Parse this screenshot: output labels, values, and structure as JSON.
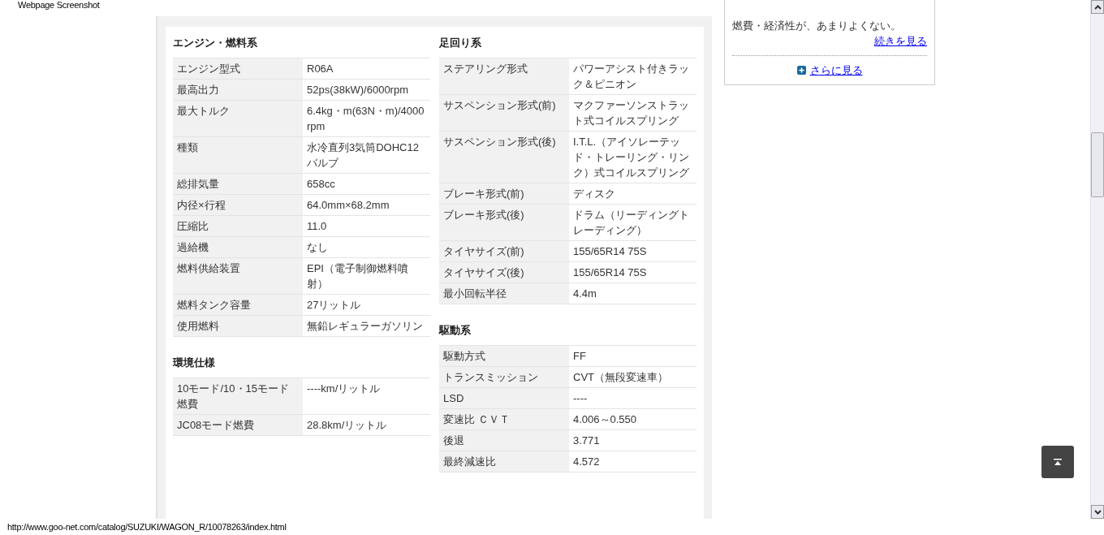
{
  "caption": "Webpage Screenshot",
  "columns": [
    {
      "sections": [
        {
          "title": "エンジン・燃料系",
          "rows": [
            {
              "label": "エンジン型式",
              "value": "R06A"
            },
            {
              "label": "最高出力",
              "value": "52ps(38kW)/6000rpm"
            },
            {
              "label": "最大トルク",
              "value": "6.4kg・m(63N・m)/4000rpm"
            },
            {
              "label": "種類",
              "value": "水冷直列3気筒DOHC12バルブ"
            },
            {
              "label": "総排気量",
              "value": "658cc"
            },
            {
              "label": "内径×行程",
              "value": "64.0mm×68.2mm"
            },
            {
              "label": "圧縮比",
              "value": "11.0"
            },
            {
              "label": "過給機",
              "value": "なし"
            },
            {
              "label": "燃料供給装置",
              "value": "EPI（電子制御燃料噴射）"
            },
            {
              "label": "燃料タンク容量",
              "value": "27リットル"
            },
            {
              "label": "使用燃料",
              "value": "無鉛レギュラーガソリン"
            }
          ]
        },
        {
          "title": "環境仕様",
          "rows": [
            {
              "label": "10モード/10・15モード燃費",
              "value": "----km/リットル"
            },
            {
              "label": "JC08モード燃費",
              "value": "28.8km/リットル"
            }
          ]
        }
      ]
    },
    {
      "sections": [
        {
          "title": "足回り系",
          "rows": [
            {
              "label": "ステアリング形式",
              "value": "パワーアシスト付きラック＆ピニオン"
            },
            {
              "label": "サスペンション形式(前)",
              "value": "マクファーソンストラット式コイルスプリング"
            },
            {
              "label": "サスペンション形式(後)",
              "value": "I.T.L.（アイソレーテッド・トレーリング・リンク）式コイルスプリング"
            },
            {
              "label": "ブレーキ形式(前)",
              "value": "ディスク"
            },
            {
              "label": "ブレーキ形式(後)",
              "value": "ドラム（リーディングトレーディング）"
            },
            {
              "label": "タイヤサイズ(前)",
              "value": "155/65R14 75S"
            },
            {
              "label": "タイヤサイズ(後)",
              "value": "155/65R14 75S"
            },
            {
              "label": "最小回転半径",
              "value": "4.4m"
            }
          ]
        },
        {
          "title": "駆動系",
          "rows": [
            {
              "label": "駆動方式",
              "value": "FF"
            },
            {
              "label": "トランスミッション",
              "value": "CVT（無段変速車）"
            },
            {
              "label": "LSD",
              "value": "----"
            },
            {
              "label": "変速比 ＣＶＴ",
              "value": "4.006～0.550"
            },
            {
              "label": "後退",
              "value": "3.771"
            },
            {
              "label": "最終減速比",
              "value": "4.572"
            }
          ]
        }
      ]
    }
  ],
  "sidebar": {
    "text": "燃費・経済性が、あまりよくない。",
    "continue_link": "続きを見る",
    "more_link": "さらに見る"
  },
  "status_bar": {
    "url": "http://www.goo-net.com/catalog/SUZUKI/WAGON_R/10078263/index.html"
  }
}
